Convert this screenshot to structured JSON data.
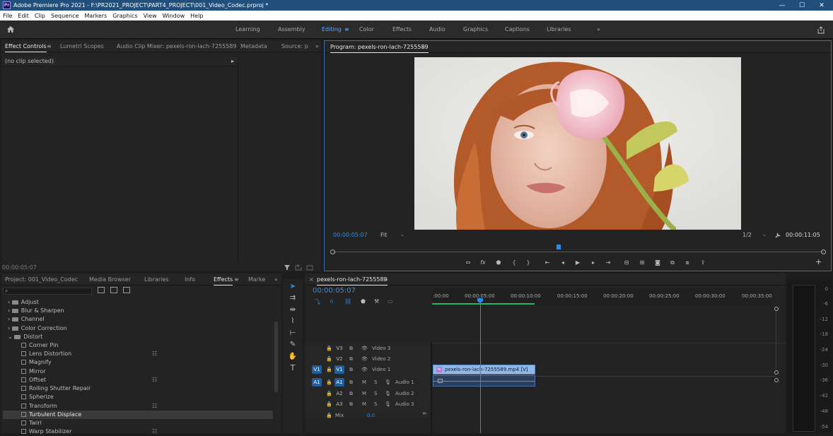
{
  "window": {
    "title": "Adobe Premiere Pro 2021 - F:\\PR2021_PROJECT\\PART4_PROJECT\\001_Video_Codec.prproj *",
    "app_badge": "Pr",
    "minimize": "—",
    "maximize": "☐",
    "close": "✕"
  },
  "menu": [
    "File",
    "Edit",
    "Clip",
    "Sequence",
    "Markers",
    "Graphics",
    "View",
    "Window",
    "Help"
  ],
  "workspaces": {
    "home_icon": "home-icon",
    "items": [
      "Learning",
      "Assembly",
      "Editing",
      "Color",
      "Effects",
      "Audio",
      "Graphics",
      "Captions",
      "Libraries"
    ],
    "active": "Editing",
    "more": "»",
    "menu_glyph": "≡"
  },
  "effect_controls": {
    "tabs": [
      "Effect Controls",
      "Lumetri Scopes",
      "Audio Clip Mixer: pexels-ron-lach-7255589",
      "Metadata",
      "Source: p"
    ],
    "more": "»",
    "menu_glyph": "≡",
    "no_clip": "(no clip selected)",
    "expand": "▸",
    "timecode": "00:00:05:07"
  },
  "program": {
    "title": "Program: pexels-ron-lach-7255589",
    "menu_glyph": "≡",
    "timecode": "00:00:05:07",
    "fit": "Fit",
    "resolution": "1/2",
    "duration": "00:00:11:05",
    "playhead_fraction": 0.46,
    "add": "+"
  },
  "project_panel": {
    "tabs": [
      "Project: 001_Video_Codec",
      "Media Browser",
      "Libraries",
      "Info",
      "Effects",
      "Marke"
    ],
    "active": "Effects",
    "more": "»",
    "menu_glyph": "≡",
    "folders": [
      "Adjust",
      "Blur & Sharpen",
      "Channel",
      "Color Correction",
      "Distort"
    ],
    "distort_effects": [
      {
        "name": "Corner Pin",
        "accel": false
      },
      {
        "name": "Lens Distortion",
        "accel": true
      },
      {
        "name": "Magnify",
        "accel": false
      },
      {
        "name": "Mirror",
        "accel": false
      },
      {
        "name": "Offset",
        "accel": true
      },
      {
        "name": "Rolling Shutter Repair",
        "accel": false
      },
      {
        "name": "Spherize",
        "accel": false
      },
      {
        "name": "Transform",
        "accel": true
      },
      {
        "name": "Turbulent Displace",
        "accel": false,
        "selected": true
      },
      {
        "name": "Twirl",
        "accel": false
      },
      {
        "name": "Warp Stabilizer",
        "accel": true
      }
    ],
    "badge": "☷",
    "collapsed": "›",
    "expanded": "⌄",
    "search_glyph": "⌕"
  },
  "timeline": {
    "close": "×",
    "sequence": "pexels-ron-lach-7255589",
    "menu_glyph": "≡",
    "timecode": "00:00:05:07",
    "ruler": [
      ":00:00",
      "00:00:05:00",
      "00:00:10:00",
      "00:00:15:00",
      "00:00:20:00",
      "00:00:25:00",
      "00:00:30:00",
      "00:00:35:00"
    ],
    "video_tracks": [
      {
        "id": "V3",
        "name": "Video 3"
      },
      {
        "id": "V2",
        "name": "Video 2"
      },
      {
        "id": "V1",
        "name": "Video 1",
        "source": "V1"
      }
    ],
    "audio_tracks": [
      {
        "id": "A1",
        "name": "Audio 1",
        "source": "A1"
      },
      {
        "id": "A2",
        "name": "Audio 2"
      },
      {
        "id": "A3",
        "name": "Audio 3"
      }
    ],
    "mute": "M",
    "solo": "S",
    "mix_label": "Mix",
    "mix_value": "0.0",
    "clip_label": "pexels-ron-lach-7255589.mp4 [V]",
    "clip_badge": "fx",
    "end": "⇤"
  },
  "audio_meter": {
    "labels": [
      "0",
      "-6",
      "-12",
      "-18",
      "-24",
      "-30",
      "-36",
      "-42",
      "-48",
      "-54"
    ]
  },
  "colors": {
    "accent": "#2d8ceb",
    "titlebar": "#1f4f7a",
    "clip": "#8fb8e8"
  }
}
